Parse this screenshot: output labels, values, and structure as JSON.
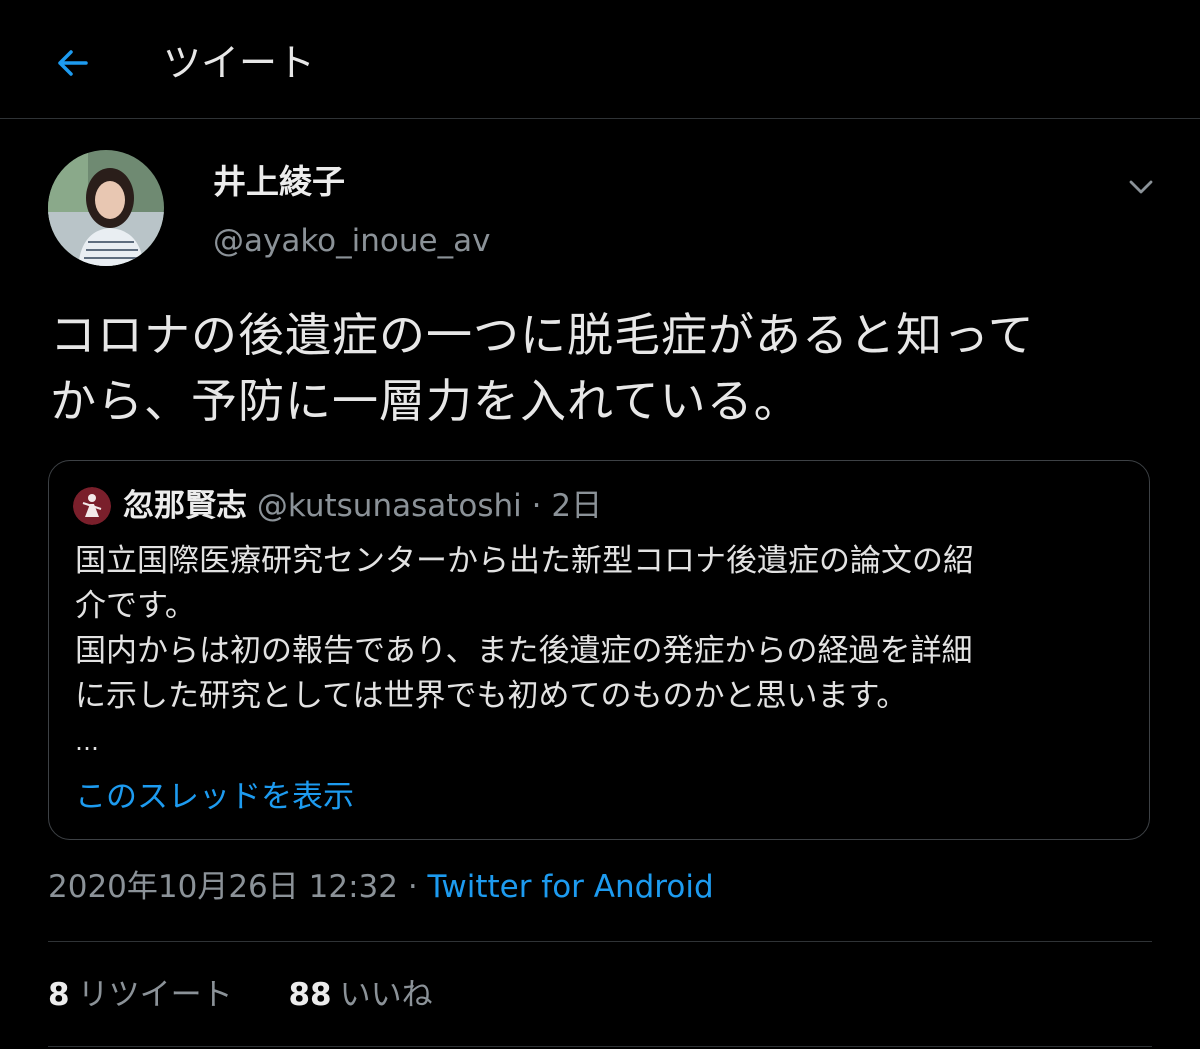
{
  "header": {
    "title": "ツイート",
    "back_icon": "arrow-left-icon",
    "accent": "#1d9bf0"
  },
  "author": {
    "name": "井上綾子",
    "handle": "@ayako_inoue_av"
  },
  "tweet": {
    "lines": [
      "コロナの後遺症の一つに脱毛症があると知って",
      "から、予防に一層力を入れている。"
    ]
  },
  "quote": {
    "name": "忽那賢志",
    "handle": "@kutsunasatoshi",
    "separator": " · ",
    "time": "2日",
    "lines": [
      "国立国際医療研究センターから出た新型コロナ後遺症の論文の紹",
      "介です。",
      "国内からは初の報告であり、また後遺症の発症からの経過を詳細",
      "に示した研究としては世界でも初めてのものかと思います。"
    ],
    "ellipsis": "…",
    "show_thread": "このスレッドを表示"
  },
  "meta": {
    "timestamp": "2020年10月26日 12:32",
    "separator": " · ",
    "source": "Twitter for Android"
  },
  "stats": {
    "retweets": {
      "count": "8",
      "label": "リツイート"
    },
    "likes": {
      "count": "88",
      "label": "いいね"
    }
  },
  "colors": {
    "background": "#000000",
    "link": "#1d9bf0",
    "secondary_text": "#8b9298",
    "divider": "#2f3336"
  }
}
